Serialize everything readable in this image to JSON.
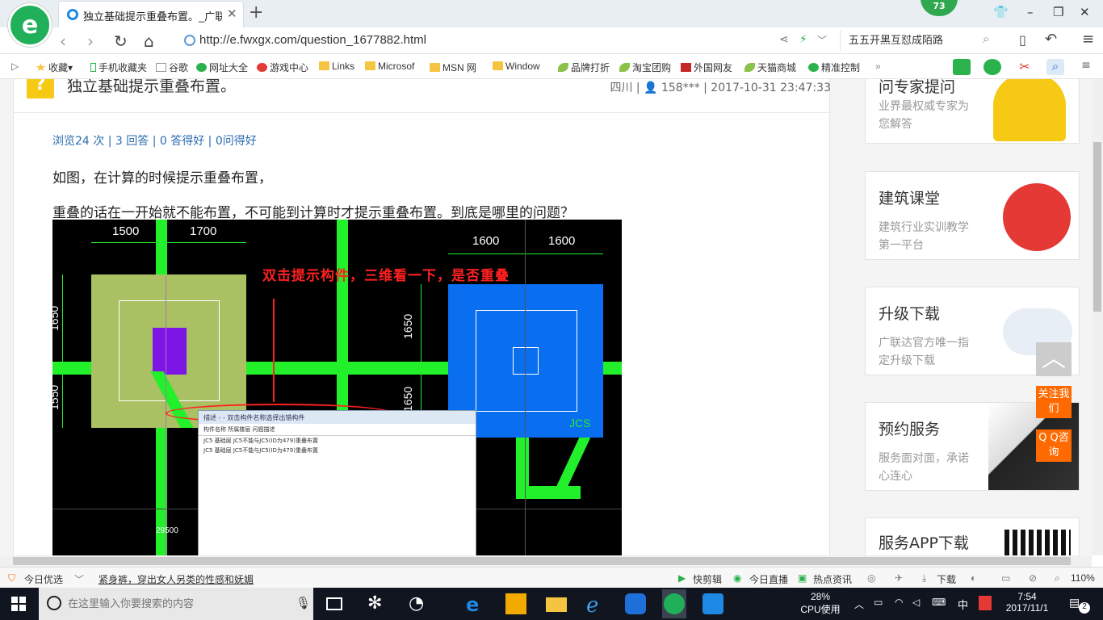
{
  "tab": {
    "title": "独立基础提示重叠布置。_广联达",
    "close": "✕",
    "new": "+"
  },
  "badge": "73",
  "window": {
    "restore": "⧉",
    "minimize": "–",
    "maximize": "❐",
    "close": "✕",
    "skin": "👕"
  },
  "nav": {
    "url": "http://e.fwxgx.com/question_1677882.html",
    "search_value": "五五开黑互怼成陌路"
  },
  "bookmarks": [
    "收藏",
    "手机收藏夹",
    "谷歌",
    "网址大全",
    "游戏中心",
    "Links",
    "Microsof",
    "MSN 网",
    "Window",
    "品牌打折",
    "淘宝团购",
    "外国网友",
    "天猫商城",
    "精准控制"
  ],
  "question": {
    "mark": "?",
    "title": "独立基础提示重叠布置。",
    "meta": "四川 | 👤 158*** | 2017-10-31 23:47:33",
    "stats": "浏览24 次 | 3 回答 | 0 答得好 | 0问得好",
    "line1": "如图，在计算的时候提示重叠布置，",
    "line2": "重叠的话在一开始就不能布置，不可能到计算时才提示重叠布置。到底是哪里的问题？"
  },
  "cad": {
    "dim_1500": "1500",
    "dim_1700": "1700",
    "dim_1600a": "1600",
    "dim_1600b": "1600",
    "dim_1650": "1650",
    "dim_1650b": "1650",
    "dim_1650c": "1650",
    "dim_1550": "1550",
    "dim_29500": "29500",
    "annotation": "双击提示构件，三维看一下，是否重叠",
    "jcs": "JCS",
    "dialog_title": "描述 - - 双击构件名称选择出错构件",
    "dialog_cols": "构件名称      所属楼层      问题描述",
    "dialog_rows": [
      "JC5          基础层      JC5不能与JC5(ID为479)重叠布置",
      "JC5          基础层      JC5不能与JC5(ID为479)重叠布置"
    ]
  },
  "sidebar": [
    {
      "title": "问专家提问",
      "sub": "业界最权威专家为您解答"
    },
    {
      "title": "建筑课堂",
      "sub": "建筑行业实训教学第一平台"
    },
    {
      "title": "升级下载",
      "sub": "广联达官方唯一指定升级下载"
    },
    {
      "title": "预约服务",
      "sub": "服务面对面，承诺心连心"
    },
    {
      "title": "服务APP下载",
      "sub": ""
    }
  ],
  "float": {
    "top": "︿",
    "follow": "关注我们",
    "qq": "Q Q咨询"
  },
  "statusbar": {
    "today": "今日优选",
    "news": "紧身裤，穿出女人另类的性感和妩媚",
    "kuaijian": "快剪辑",
    "live": "今日直播",
    "hot": "热点资讯",
    "download": "下载",
    "zoom": "110%"
  },
  "taskbar": {
    "search_placeholder": "在这里输入你要搜索的内容",
    "cpu_pct": "28%",
    "cpu_label": "CPU使用",
    "ime": "中",
    "time": "7:54",
    "date": "2017/11/1",
    "notif": "2"
  },
  "colors": {
    "green": "#21f02a",
    "blue_foundation": "#0a6ef0",
    "tan_foundation": "#a9c063",
    "purple": "#7d15e6",
    "accent_orange": "#ff6a00"
  }
}
